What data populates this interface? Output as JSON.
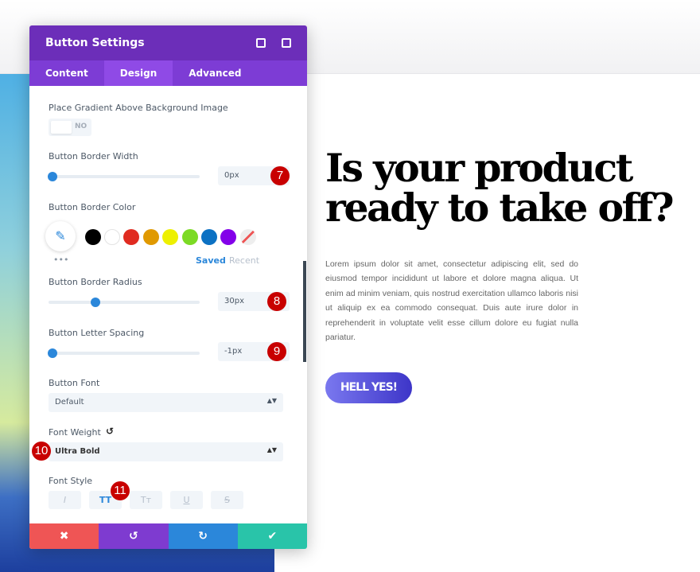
{
  "panel": {
    "title": "Button Settings",
    "icons": [
      "fullscreen-icon",
      "sidebar-icon"
    ],
    "tabs": [
      "Content",
      "Design",
      "Advanced"
    ],
    "active_tab": "Design",
    "gradient_label": "Place Gradient Above Background Image",
    "gradient_value": "NO",
    "border_width_label": "Button Border Width",
    "border_width": "0px",
    "border_width_pct": 0,
    "border_color_label": "Button Border Color",
    "swatches": [
      "#000000",
      "#ffffff",
      "#e02b20",
      "#e09900",
      "#edf000",
      "#7cda24",
      "#0c71c3",
      "#8300e9"
    ],
    "saved": "Saved",
    "recent": "Recent",
    "more": "•••",
    "radius_label": "Button Border Radius",
    "radius": "30px",
    "radius_pct": 30,
    "spacing_label": "Button Letter Spacing",
    "spacing": "-1px",
    "spacing_pct": 0,
    "font_label": "Button Font",
    "font": "Default",
    "weight_label": "Font Weight",
    "weight": "Ultra Bold",
    "style_label": "Font Style",
    "styles": [
      "I",
      "TT",
      "Tт",
      "U",
      "S"
    ],
    "badges": [
      "7",
      "8",
      "9",
      "10",
      "11"
    ],
    "footer": [
      "✖",
      "↺",
      "↻",
      "✔"
    ]
  },
  "page": {
    "heading": "Is your product ready to take off?",
    "paragraph": "Lorem ipsum dolor sit amet, consectetur adipiscing elit, sed do eiusmod tempor incididunt ut labore et dolore magna aliqua. Ut enim ad minim veniam, quis nostrud exercitation ullamco laboris nisi ut aliquip ex ea commodo consequat. Duis aute irure dolor in reprehenderit in voluptate velit esse cillum dolore eu fugiat nulla pariatur.",
    "button": "HELL YES!"
  }
}
